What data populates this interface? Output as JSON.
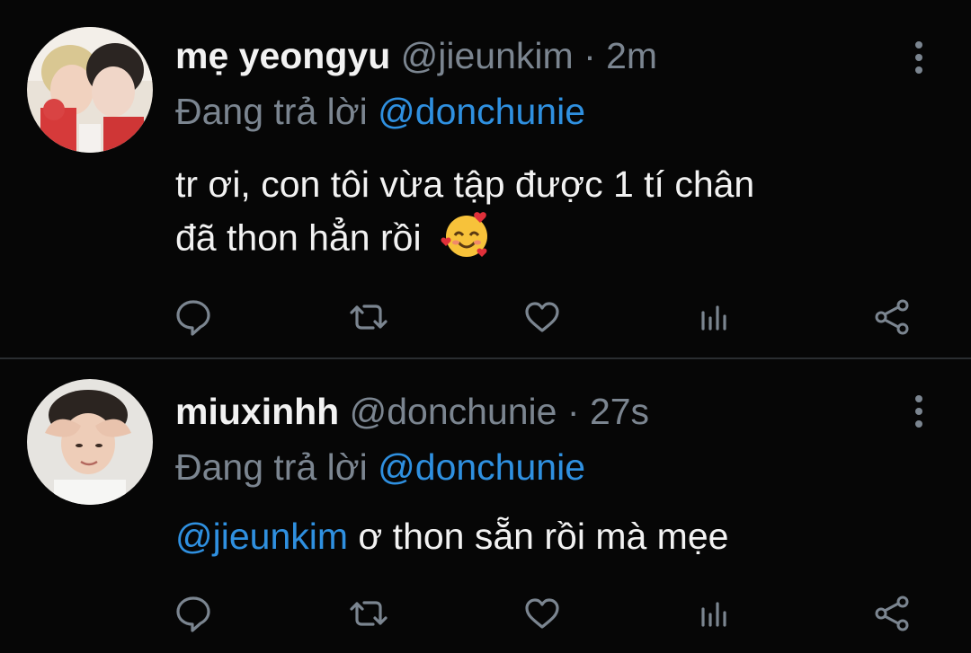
{
  "tweets": [
    {
      "name": "mẹ yeongyu",
      "handle": "@jieunkim",
      "separator": "·",
      "time": "2m",
      "reply_prefix": "Đang trả lời",
      "reply_to": "@donchunie",
      "text_line1": "tr ơi, con tôi vừa tập được 1 tí chân",
      "text_line2": "đã thon hẳn rồi",
      "emoji": "🥰",
      "avatar_icon": "avatar-photo",
      "actions": [
        "reply-icon",
        "retweet-icon",
        "like-icon",
        "analytics-icon",
        "share-icon"
      ]
    },
    {
      "name": "miuxinhh",
      "handle": "@donchunie",
      "separator": "·",
      "time": "27s",
      "reply_prefix": "Đang trả lời",
      "reply_to": "@donchunie",
      "text_mention": "@jieunkim",
      "text_rest": " ơ thon sẵn rồi mà mẹe",
      "avatar_icon": "avatar-photo",
      "actions": [
        "reply-icon",
        "retweet-icon",
        "like-icon",
        "analytics-icon",
        "share-icon"
      ]
    }
  ],
  "colors": {
    "background": "#060606",
    "text": "#f2f2f2",
    "secondary": "#7b8590",
    "mention": "#2f90e0",
    "divider": "#2a2d30"
  }
}
